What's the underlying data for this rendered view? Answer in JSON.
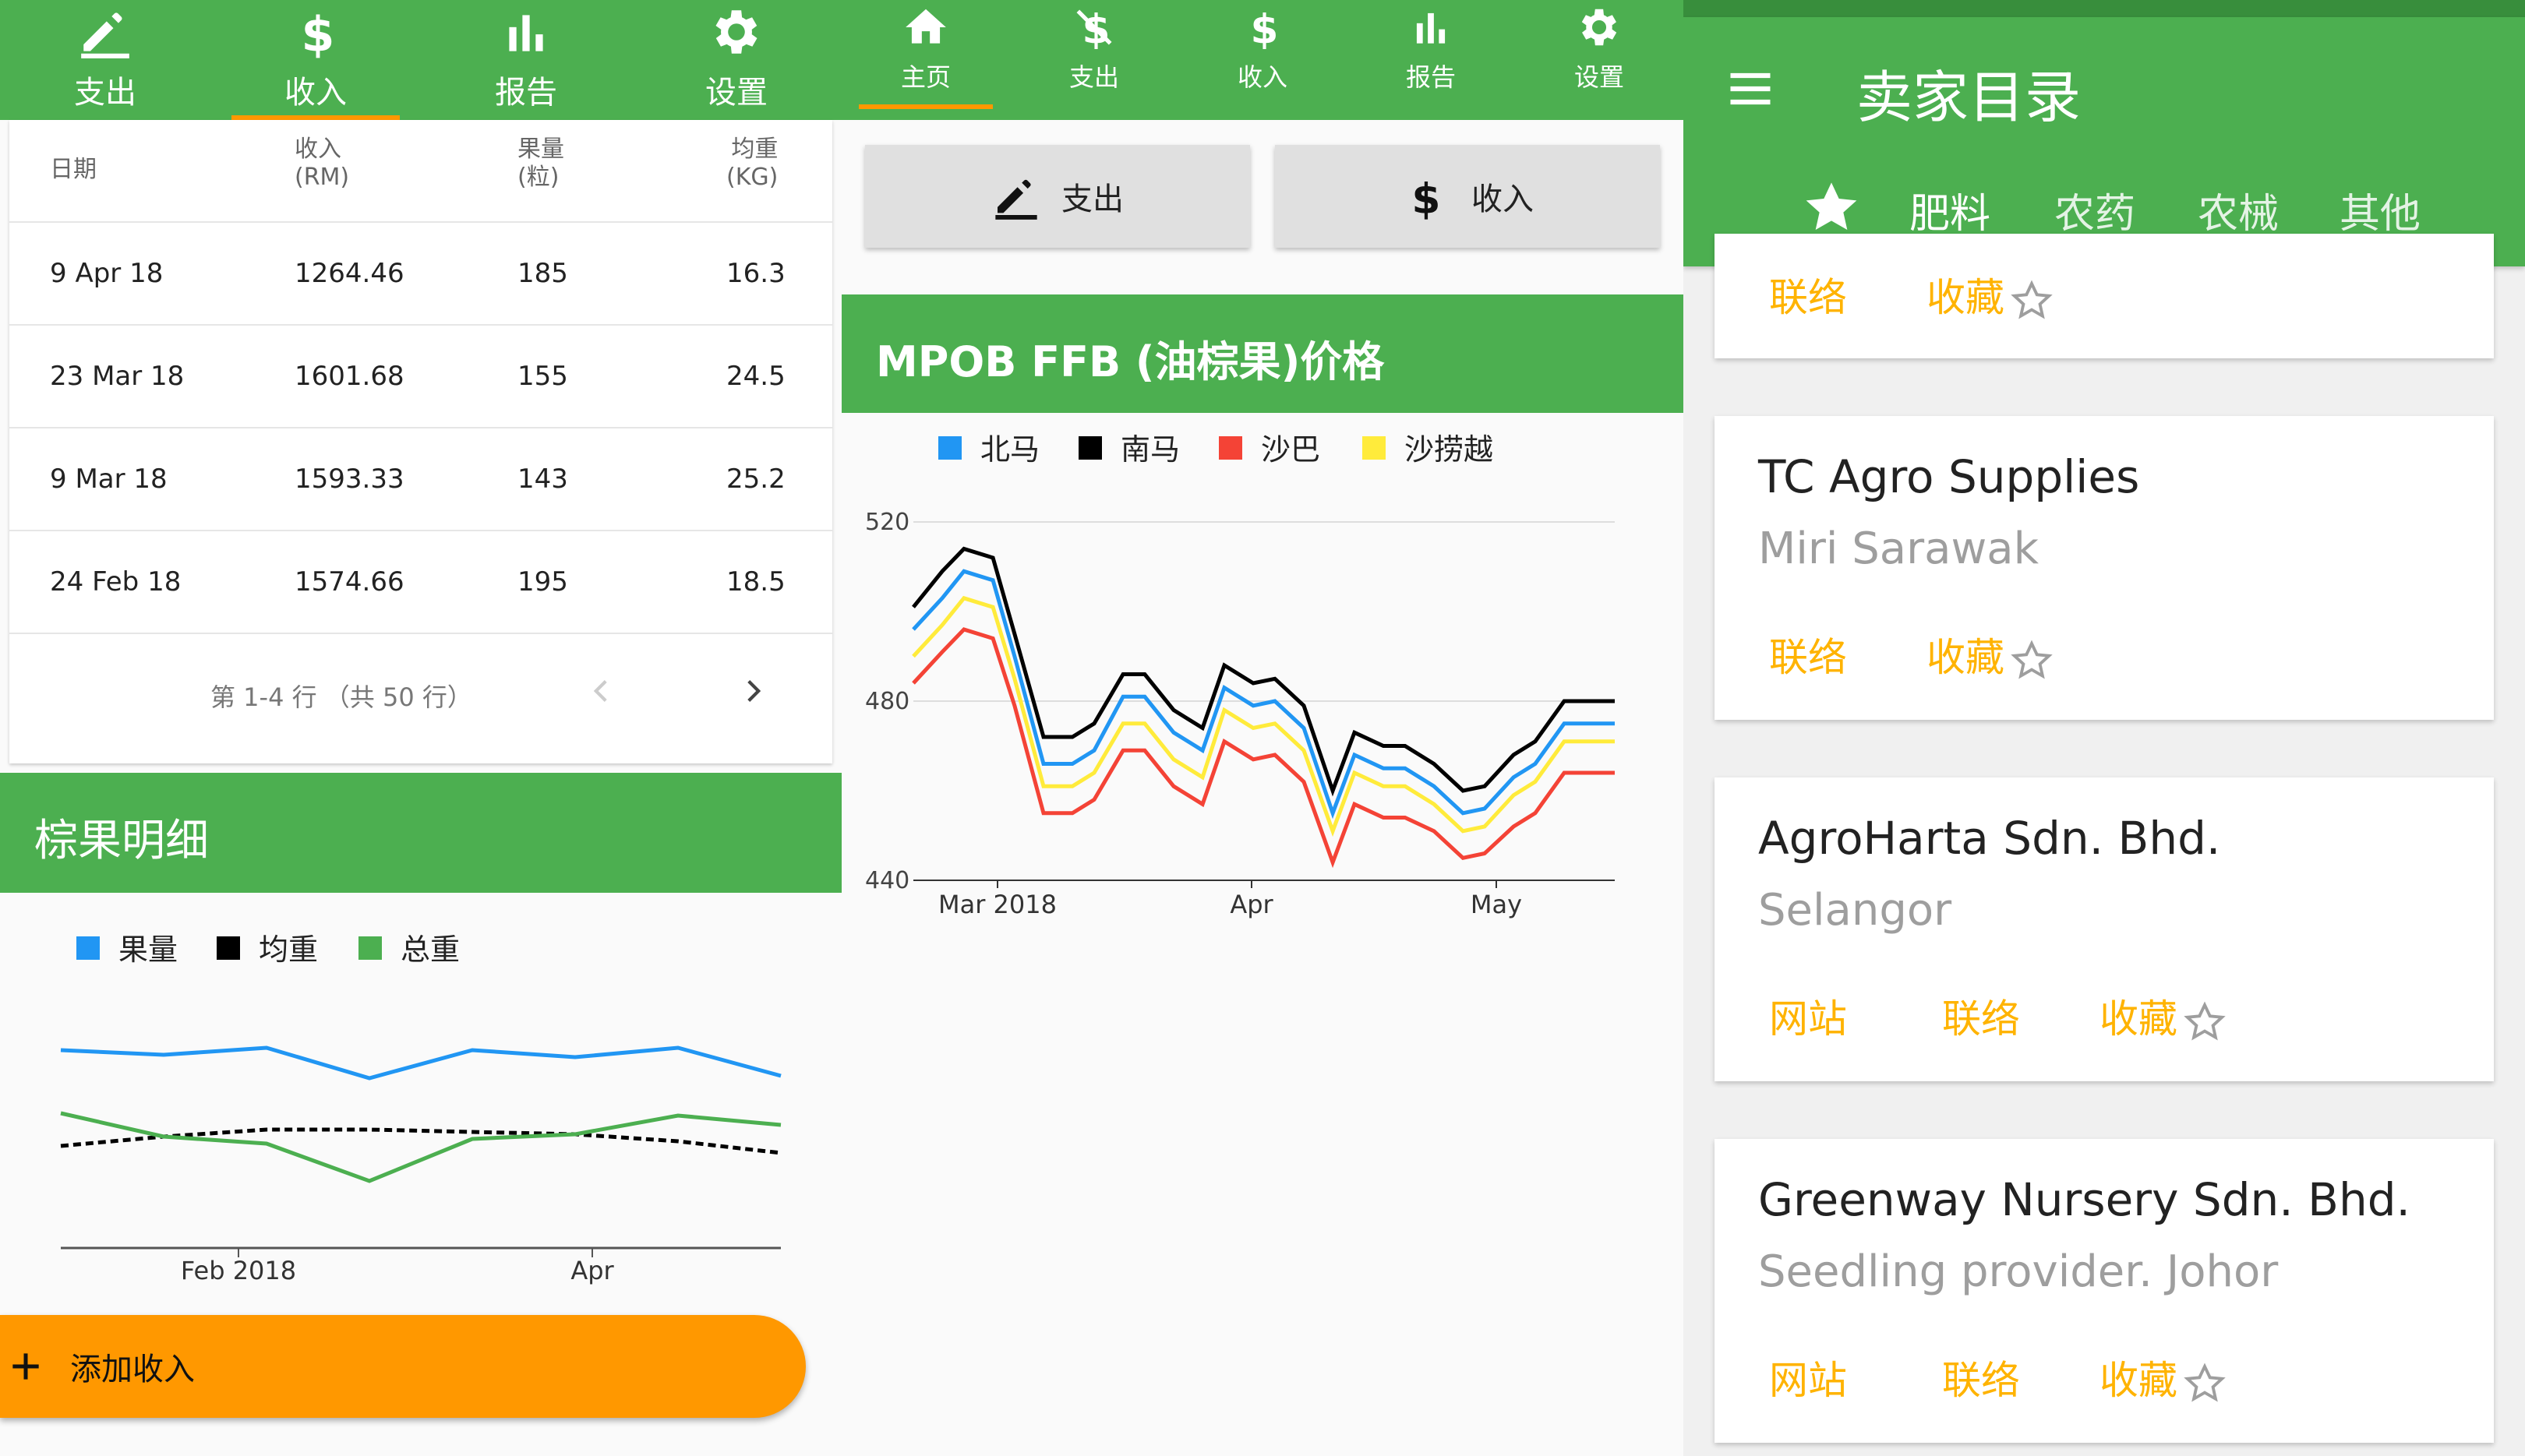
{
  "colors": {
    "primary": "#4caf50",
    "accent": "#ff9800",
    "yellow_text": "#ffb300"
  },
  "s1": {
    "tabs": [
      {
        "label": "支出",
        "icon": "pencil-icon"
      },
      {
        "label": "收入",
        "icon": "dollar-icon",
        "active": true
      },
      {
        "label": "报告",
        "icon": "bar-chart-icon"
      },
      {
        "label": "设置",
        "icon": "gear-icon"
      }
    ],
    "table": {
      "headers": [
        {
          "l1": "日期",
          "l2": ""
        },
        {
          "l1": "收入",
          "l2": "(RM)"
        },
        {
          "l1": "果量",
          "l2": "(粒)"
        },
        {
          "l1": "均重",
          "l2": "(KG)"
        }
      ],
      "rows": [
        [
          "9 Apr 18",
          "1264.46",
          "185",
          "16.3"
        ],
        [
          "23 Mar 18",
          "1601.68",
          "155",
          "24.5"
        ],
        [
          "9 Mar 18",
          "1593.33",
          "143",
          "25.2"
        ],
        [
          "24 Feb 18",
          "1574.66",
          "195",
          "18.5"
        ]
      ],
      "pagination": "第 1-4 行 （共 50 行）"
    },
    "section_title": "棕果明细",
    "fab_label": "添加收入"
  },
  "s2": {
    "tabs": [
      {
        "label": "主页",
        "icon": "home-icon",
        "active": true
      },
      {
        "label": "支出",
        "icon": "money-off-icon"
      },
      {
        "label": "收入",
        "icon": "dollar-icon"
      },
      {
        "label": "报告",
        "icon": "bar-chart-icon"
      },
      {
        "label": "设置",
        "icon": "gear-icon"
      }
    ],
    "btn_expense": "支出",
    "btn_income": "收入",
    "section_title": "MPOB FFB (油棕果)价格"
  },
  "s3": {
    "title": "卖家目录",
    "tabs": [
      "肥料",
      "农药",
      "农械",
      "其他"
    ],
    "active_tab": 0,
    "partial_card": {
      "actions": [
        "联络",
        "收藏"
      ]
    },
    "sellers": [
      {
        "name": "TC Agro Supplies",
        "location": "Miri Sarawak",
        "actions": [
          "联络",
          "收藏"
        ]
      },
      {
        "name": "AgroHarta Sdn. Bhd.",
        "location": "Selangor",
        "actions": [
          "网站",
          "联络",
          "收藏"
        ]
      },
      {
        "name": "Greenway Nursery Sdn. Bhd.",
        "location": "Seedling provider. Johor",
        "actions": [
          "网站",
          "联络",
          "收藏"
        ]
      }
    ]
  },
  "chart_data": [
    {
      "type": "line",
      "title": "",
      "x": [
        "2018-01-15",
        "2018-01-29",
        "2018-02-12",
        "2018-02-26",
        "2018-03-12",
        "2018-03-26",
        "2018-04-09",
        "2018-04-23"
      ],
      "x_ticks": [
        "Feb 2018",
        "Apr"
      ],
      "legend": [
        "果量",
        "均重",
        "总重"
      ],
      "series": [
        {
          "name": "果量",
          "color": "#2196f3",
          "values": [
            0.84,
            0.82,
            0.85,
            0.72,
            0.84,
            0.81,
            0.85,
            0.73
          ]
        },
        {
          "name": "均重",
          "color": "#000000",
          "dashed": true,
          "values": [
            0.43,
            0.47,
            0.5,
            0.5,
            0.49,
            0.48,
            0.45,
            0.4
          ]
        },
        {
          "name": "总重",
          "color": "#4caf50",
          "values": [
            0.57,
            0.47,
            0.44,
            0.28,
            0.46,
            0.48,
            0.56,
            0.52
          ]
        }
      ],
      "ylim": [
        0,
        1
      ],
      "axes": "hidden-y",
      "legend_position": "top-left"
    },
    {
      "type": "line",
      "title": "MPOB FFB (油棕果)价格",
      "x_ticks": [
        "Mar 2018",
        "Apr",
        "May"
      ],
      "ylim": [
        440,
        520
      ],
      "y_ticks": [
        "520",
        "480",
        "440"
      ],
      "legend": [
        "北马",
        "南马",
        "沙巴",
        "沙捞越"
      ],
      "legend_position": "top-left",
      "x": [
        0,
        4,
        7,
        11,
        14,
        18,
        22,
        25,
        29,
        32,
        36,
        40,
        43,
        47,
        50,
        54,
        58,
        61,
        65,
        68,
        72,
        76,
        79,
        83,
        86,
        90,
        94,
        97
      ],
      "series": [
        {
          "name": "南马",
          "color": "#000000",
          "values": [
            501,
            509,
            514,
            512,
            495,
            472,
            472,
            475,
            486,
            486,
            478,
            474,
            488,
            484,
            485,
            479,
            460,
            473,
            470,
            470,
            466,
            460,
            461,
            468,
            471,
            480,
            480,
            480
          ]
        },
        {
          "name": "北马",
          "color": "#2196f3",
          "values": [
            496,
            503,
            509,
            507,
            490,
            466,
            466,
            469,
            481,
            481,
            473,
            469,
            483,
            479,
            480,
            474,
            455,
            468,
            465,
            465,
            461,
            455,
            456,
            463,
            466,
            475,
            475,
            475
          ]
        },
        {
          "name": "沙捞越",
          "color": "#ffeb3b",
          "values": [
            490,
            497,
            503,
            501,
            485,
            461,
            461,
            464,
            475,
            475,
            467,
            463,
            478,
            474,
            475,
            469,
            451,
            464,
            461,
            461,
            457,
            451,
            452,
            459,
            462,
            471,
            471,
            471
          ]
        },
        {
          "name": "沙巴",
          "color": "#f44336",
          "values": [
            484,
            491,
            496,
            494,
            479,
            455,
            455,
            458,
            469,
            469,
            461,
            457,
            471,
            467,
            468,
            462,
            444,
            457,
            454,
            454,
            451,
            445,
            446,
            452,
            455,
            464,
            464,
            464
          ]
        }
      ]
    }
  ]
}
